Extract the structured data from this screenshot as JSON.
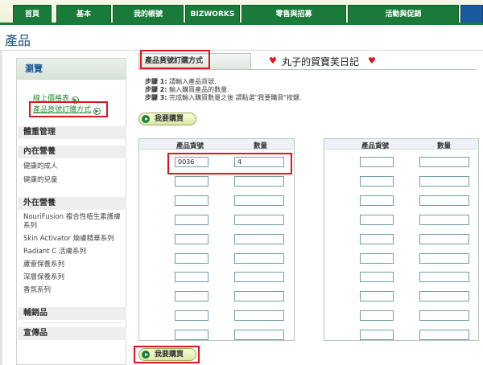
{
  "nav": {
    "tabs": [
      "首頁",
      "基本",
      "我的帳號",
      "BIZWORKS",
      "零售與招募",
      "活動與促銷",
      ""
    ]
  },
  "page": {
    "title": "產品"
  },
  "sidebar": {
    "header": "瀏覽",
    "links": [
      "線上價格表",
      "產品貨號訂購方式"
    ],
    "sections": {
      "body_care": "體重管理",
      "inner": "內在營養",
      "outer": "外在營養",
      "aux": "輔銷品",
      "promo": "宣傳品"
    },
    "inner_items": [
      "健康的成人",
      "健康的兒童"
    ],
    "outer_items": [
      "NouriFusion 複合性植生素護膚系列",
      "Skin Activator 煥膚精華系列",
      "Radiant C 活膚系列",
      "蘆薈保養系列",
      "深層保養系列",
      "香氛系列"
    ]
  },
  "main": {
    "tab_label": "產品貨號訂購方式",
    "blog": "丸子的貿寶芙日記",
    "steps": [
      {
        "label": "步驟 1:",
        "text": "請輸入產品貨號."
      },
      {
        "label": "步驟 2:",
        "text": "輸入購買產品的數量."
      },
      {
        "label": "步驟 3:",
        "text": "完成輸入購買數量之後 請點選\"我要購買\"按鍵."
      }
    ],
    "buy_button": "我要購買",
    "table": {
      "col_product": "產品貨號",
      "col_qty": "數量",
      "row1_product": "0036",
      "row1_qty": "4"
    }
  }
}
